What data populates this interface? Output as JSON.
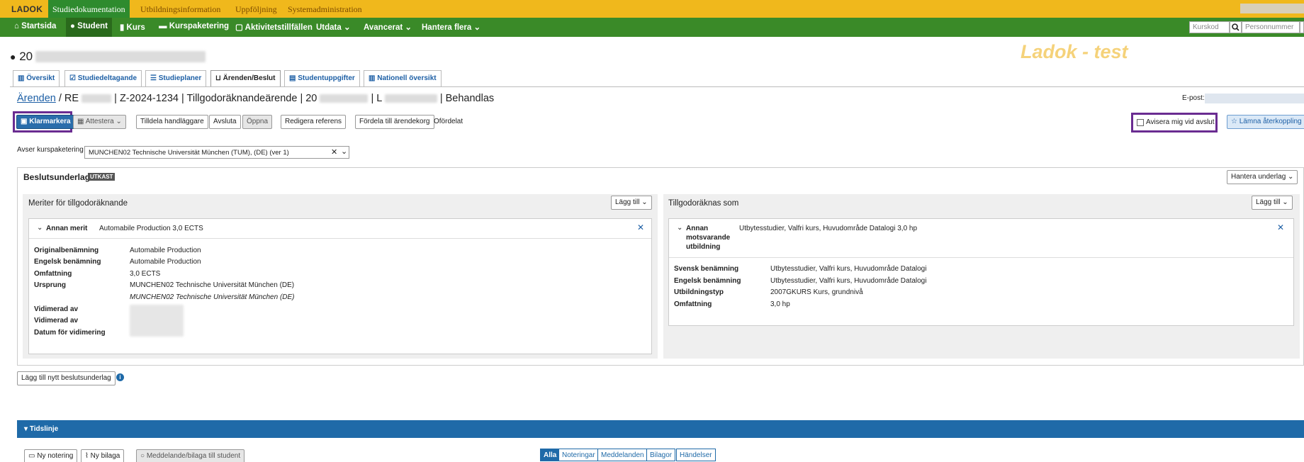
{
  "topbar": {
    "logo": "LADOK",
    "tabs": [
      "Studiedokumentation",
      "Utbildningsinformation",
      "Uppföljning",
      "Systemadministration"
    ]
  },
  "nav": {
    "items": [
      "Startsida",
      "Student",
      "Kurs",
      "Kurspaketering",
      "Aktivitetstillfällen",
      "Utdata",
      "Avancerat",
      "Hantera flera"
    ],
    "kurskod_placeholder": "Kurskod",
    "personnummer_placeholder": "Personnummer"
  },
  "person": {
    "id_prefix": "20"
  },
  "watermark": "Ladok - test",
  "tabs": [
    "Översikt",
    "Studiedeltagande",
    "Studieplaner",
    "Ärenden/Beslut",
    "Studentuppgifter",
    "Nationell översikt"
  ],
  "breadcrumb": {
    "link": "Ärenden",
    "ref_prefix": "RE",
    "case": "Z-2024-1234",
    "type": "Tillgodoräknandeärende",
    "id_prefix": "20",
    "l_prefix": "L",
    "status": "Behandlas"
  },
  "epost_label": "E-post:",
  "actions": {
    "klarmarkera": "Klarmarkera",
    "attestera": "Attestera",
    "tilldela": "Tilldela handläggare",
    "avsluta": "Avsluta",
    "oppna": "Öppna",
    "redigera": "Redigera referens",
    "fordela": "Fördela till ärendekorg",
    "ofordelat": "Ofördelat",
    "avisera": "Avisera mig vid avslut",
    "lamna": "Lämna återkoppling"
  },
  "kurspaketering": {
    "label": "Avser kurspaketering",
    "value": "MUNCHEN02 Technische Universität München (TUM), (DE) (ver 1)"
  },
  "beslutsunderlag": {
    "title": "Beslutsunderlag",
    "badge": "UTKAST",
    "hantera": "Hantera underlag",
    "left": {
      "title": "Meriter för tillgodoräknande",
      "add": "Lägg till",
      "card_type": "Annan merit",
      "card_summary": "Automabile Production 3,0 ECTS",
      "rows": [
        {
          "label": "Originalbenämning",
          "value": "Automabile Production"
        },
        {
          "label": "Engelsk benämning",
          "value": "Automabile Production"
        },
        {
          "label": "Omfattning",
          "value": "3,0 ECTS"
        },
        {
          "label": "Ursprung",
          "value": "MUNCHEN02 Technische Universität München (DE)"
        }
      ],
      "ursprung_italic": "MUNCHEN02 Technische Universität München (DE)",
      "vidimerad1": "Vidimerad av",
      "vidimerad2": "Vidimerad av",
      "datum": "Datum för vidimering"
    },
    "right": {
      "title": "Tillgodoräknas som",
      "add": "Lägg till",
      "card_type_1": "Annan",
      "card_type_2": "motsvarande",
      "card_type_3": "utbildning",
      "card_summary": "Utbytesstudier, Valfri kurs, Huvudområde Datalogi 3,0 hp",
      "rows": [
        {
          "label": "Svensk benämning",
          "value": "Utbytesstudier, Valfri kurs, Huvudområde Datalogi"
        },
        {
          "label": "Engelsk benämning",
          "value": "Utbytesstudier, Valfri kurs, Huvudområde Datalogi"
        },
        {
          "label": "Utbildningstyp",
          "value": "2007GKURS Kurs, grundnivå"
        },
        {
          "label": "Omfattning",
          "value": "3,0 hp"
        }
      ]
    }
  },
  "add_new": "Lägg till nytt beslutsunderlag",
  "timeline": {
    "title": "Tidslinje",
    "buttons": [
      "Ny notering",
      "Ny bilaga",
      "Meddelande/bilaga till student"
    ],
    "filters": [
      "Alla",
      "Noteringar",
      "Meddelanden",
      "Bilagor",
      "Händelser"
    ]
  }
}
